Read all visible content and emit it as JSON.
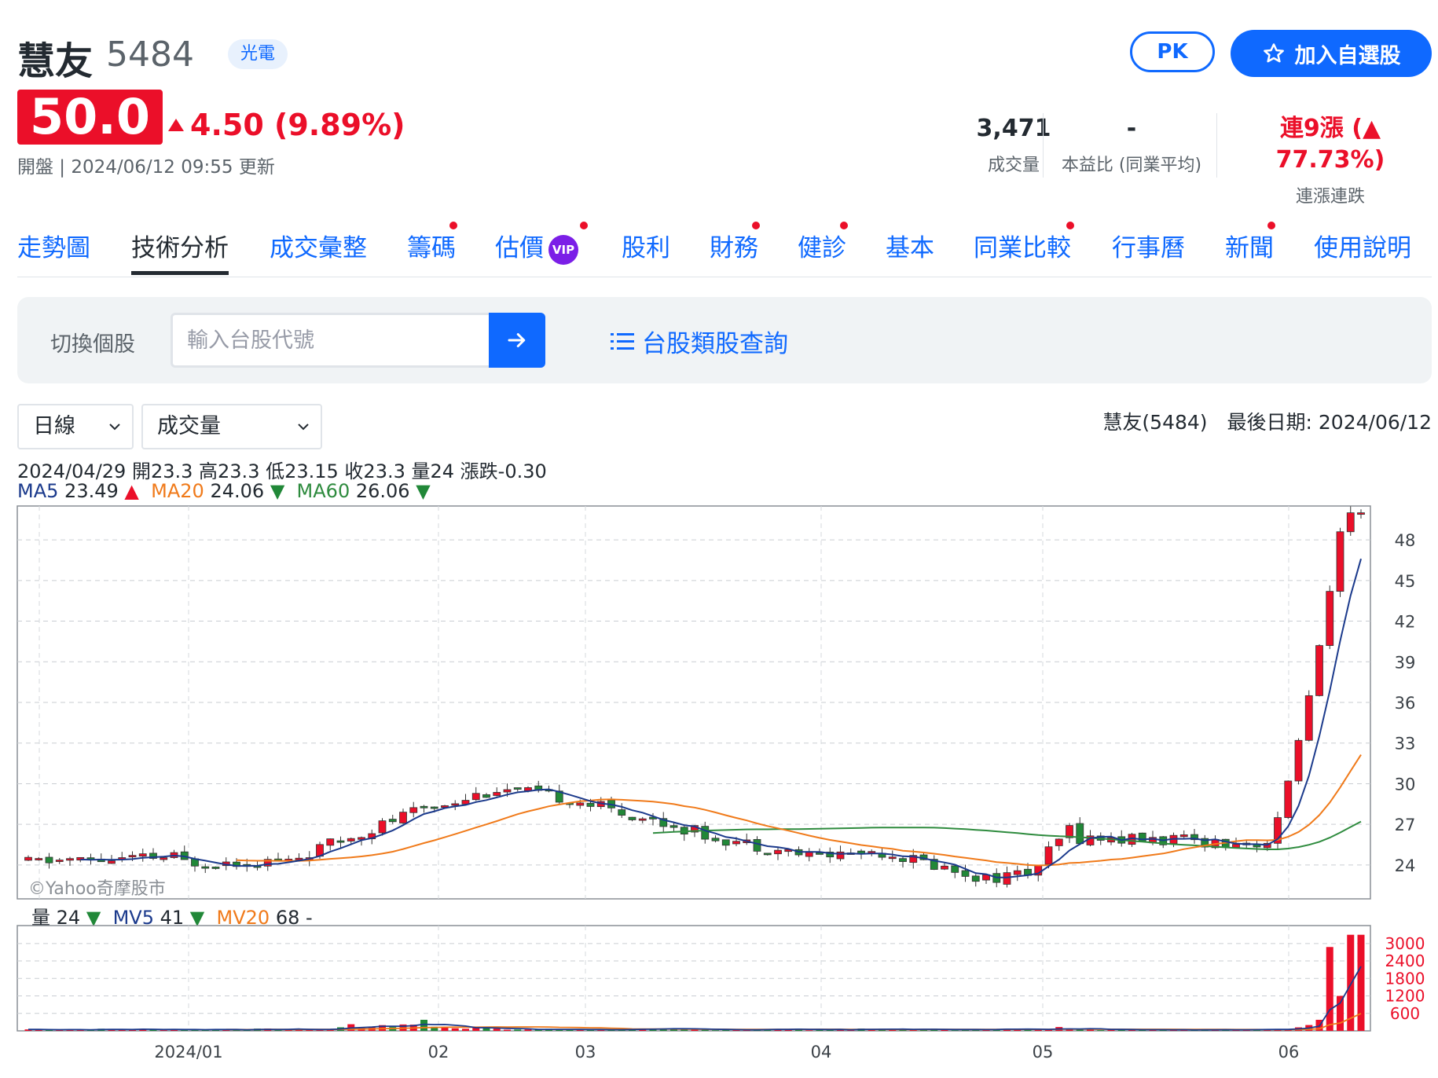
{
  "stock": {
    "name": "慧友",
    "code": "5484",
    "sector": "光電",
    "price": "50.0",
    "change": "4.50 (9.89%)",
    "status": "開盤 | 2024/06/12 09:55 更新"
  },
  "actions": {
    "pk": "PK",
    "watchlist": "加入自選股"
  },
  "stats": [
    {
      "value": "3,471",
      "label": "成交量"
    },
    {
      "value": "-",
      "label": "本益比 (同業平均)"
    },
    {
      "value": "連9漲 (▲ 77.73%)",
      "label": "連漲連跌"
    }
  ],
  "tabs": [
    {
      "label": "走勢圖",
      "active": false,
      "dot": false
    },
    {
      "label": "技術分析",
      "active": true,
      "dot": false
    },
    {
      "label": "成交彙整",
      "active": false,
      "dot": false
    },
    {
      "label": "籌碼",
      "active": false,
      "dot": true
    },
    {
      "label": "估價",
      "active": false,
      "dot": true,
      "badge": "VIP"
    },
    {
      "label": "股利",
      "active": false,
      "dot": false
    },
    {
      "label": "財務",
      "active": false,
      "dot": true
    },
    {
      "label": "健診",
      "active": false,
      "dot": true
    },
    {
      "label": "基本",
      "active": false,
      "dot": false
    },
    {
      "label": "同業比較",
      "active": false,
      "dot": true
    },
    {
      "label": "行事曆",
      "active": false,
      "dot": false
    },
    {
      "label": "新聞",
      "active": false,
      "dot": true
    },
    {
      "label": "使用說明",
      "active": false,
      "dot": false
    }
  ],
  "search": {
    "label": "切換個股",
    "placeholder": "輸入台股代號",
    "category_link": "台股類股查詢"
  },
  "controls": {
    "period": "日線",
    "indicator": "成交量"
  },
  "chart_caption": "慧友(5484)　最後日期: 2024/06/12",
  "ohlc_line": "2024/04/29 開23.3 高23.3 低23.15 收23.3 量24 漲跌-0.30",
  "ma_legend": [
    {
      "name": "MA5",
      "value": "23.49",
      "arrow": "▲",
      "color": "#1b3a8c",
      "arrow_color": "#eb0f29"
    },
    {
      "name": "MA20",
      "value": "24.06",
      "arrow": "▼",
      "color": "#f07a1a",
      "arrow_color": "#218838"
    },
    {
      "name": "MA60",
      "value": "26.06",
      "arrow": "▼",
      "color": "#2e8b3e",
      "arrow_color": "#218838"
    }
  ],
  "vol_legend": [
    {
      "name": "量",
      "value": "24",
      "arrow": "▼",
      "color": "#232a31",
      "arrow_color": "#218838"
    },
    {
      "name": "MV5",
      "value": "41",
      "arrow": "▼",
      "color": "#1b3a8c",
      "arrow_color": "#218838"
    },
    {
      "name": "MV20",
      "value": "68",
      "arrow": "-",
      "color": "#f07a1a",
      "arrow_color": "#232a31"
    }
  ],
  "watermark": "©Yahoo奇摩股市",
  "colors": {
    "up": "#eb0f29",
    "down": "#218838",
    "accent": "#0f69ff"
  },
  "chart_data": {
    "type": "candlestick",
    "x_ticks": [
      "2024/01",
      "02",
      "03",
      "04",
      "05",
      "06"
    ],
    "price_ticks": [
      24,
      27,
      30,
      33,
      36,
      39,
      42,
      45,
      48
    ],
    "price_range": [
      21.5,
      50.5
    ],
    "volume_ticks": [
      600,
      1200,
      1800,
      2400,
      3000
    ],
    "volume_range": [
      0,
      3400
    ],
    "grid": true,
    "ma_colors": {
      "MA5": "#1b3a8c",
      "MA20": "#f07a1a",
      "MA60": "#2e8b3e"
    }
  }
}
